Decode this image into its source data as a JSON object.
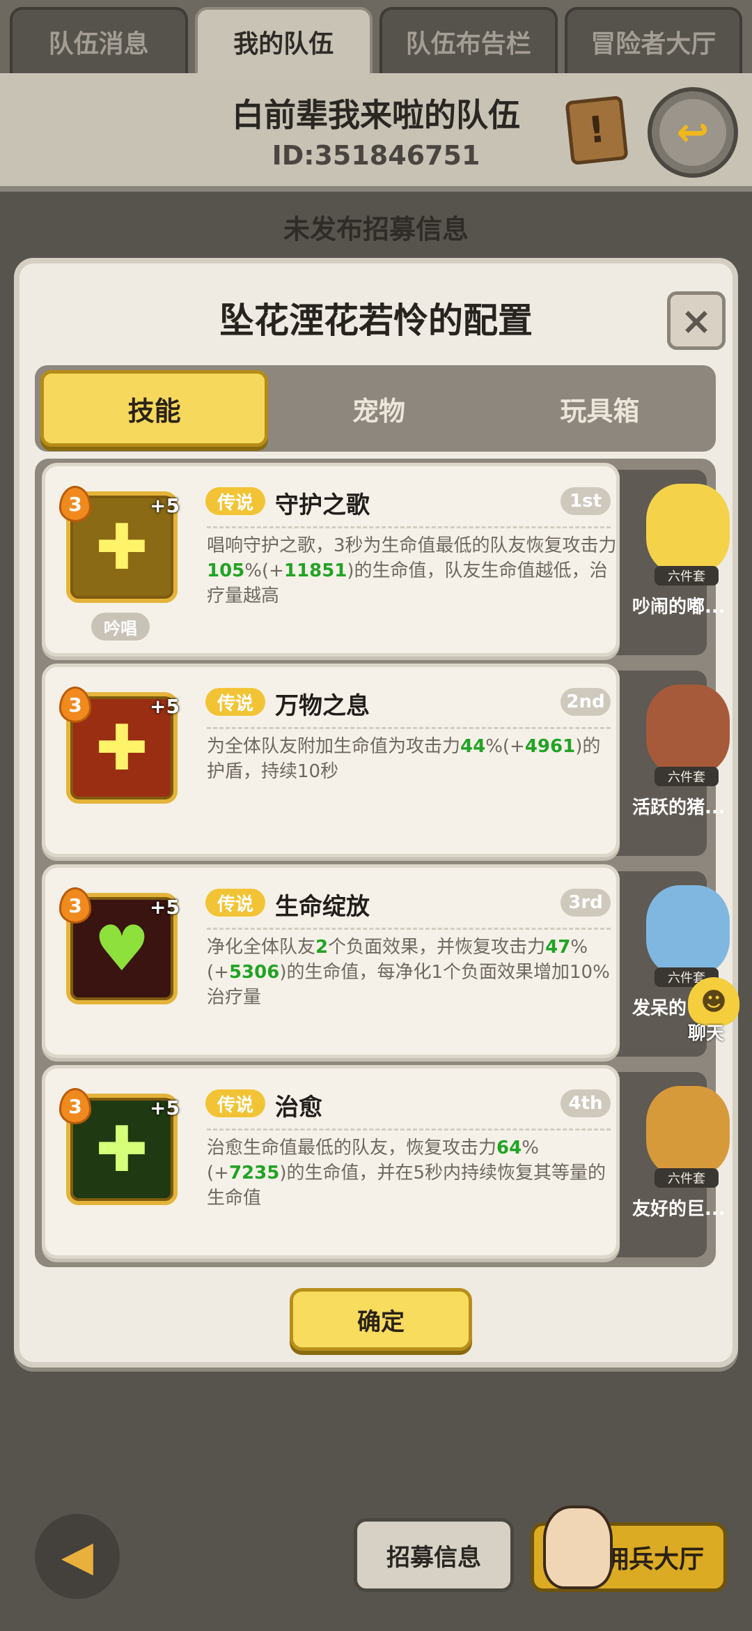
{
  "top_tabs": [
    "队伍消息",
    "我的队伍",
    "队伍布告栏",
    "冒险者大厅"
  ],
  "team": {
    "name": "白前辈我来啦的队伍",
    "id": "ID:351846751"
  },
  "unpublished": "未发布招募信息",
  "modal": {
    "title": "坠花湮花若怜的配置",
    "close_label": "×",
    "tabs": [
      "技能",
      "宠物",
      "玩具箱"
    ],
    "confirm": "确定"
  },
  "skills": [
    {
      "rarity": "传说",
      "name": "守护之歌",
      "rank": "1st",
      "level": "3",
      "plus": "+5",
      "tag": "吟唱",
      "desc_a": "唱响守护之歌，3秒为生命值最低的队友恢复攻击力",
      "g1": "105",
      "desc_b": "%(+",
      "g2": "11851",
      "desc_c": ")的生命值，队友生命值越低，治疗量越高"
    },
    {
      "rarity": "传说",
      "name": "万物之息",
      "rank": "2nd",
      "level": "3",
      "plus": "+5",
      "desc_a": "为全体队友附加生命值为攻击力",
      "g1": "44",
      "desc_b": "%(+",
      "g2": "4961",
      "desc_c": ")的护盾，持续10秒"
    },
    {
      "rarity": "传说",
      "name": "生命绽放",
      "rank": "3rd",
      "level": "3",
      "plus": "+5",
      "desc_a": "净化全体队友",
      "g0": "2",
      "desc_a2": "个负面效果，并恢复攻击力",
      "g1": "47",
      "desc_b": "%(+",
      "g2": "5306",
      "desc_c": ")的生命值，每净化1个负面效果增加10%治疗量"
    },
    {
      "rarity": "传说",
      "name": "治愈",
      "rank": "4th",
      "level": "3",
      "plus": "+5",
      "desc_a": "治愈生命值最低的队友，恢复攻击力",
      "g1": "64",
      "desc_b": "%(+",
      "g2": "7235",
      "desc_c": ")的生命值，并在5秒内持续恢复其等量的生命值"
    }
  ],
  "pets": [
    {
      "name": "吵闹的嘟...",
      "badge": "六件套"
    },
    {
      "name": "活跃的猪...",
      "badge": "六件套"
    },
    {
      "name": "发呆的",
      "badge": "六件套"
    },
    {
      "name": "友好的巨...",
      "badge": "六件套"
    }
  ],
  "chat": {
    "label": "聊天"
  },
  "bottom": {
    "recruit": "招募信息",
    "mercenary": "佣兵大厅"
  },
  "colors": {
    "gold": "#f6d85c",
    "rarity": "#f2c335",
    "green": "#22a326",
    "background": "#57534d",
    "panel": "#efebe3"
  },
  "icons": {
    "team_notice": "scroll-icon",
    "exit": "exit-icon",
    "back": "back-arrow-icon",
    "chat": "chat-bubble-icon"
  }
}
